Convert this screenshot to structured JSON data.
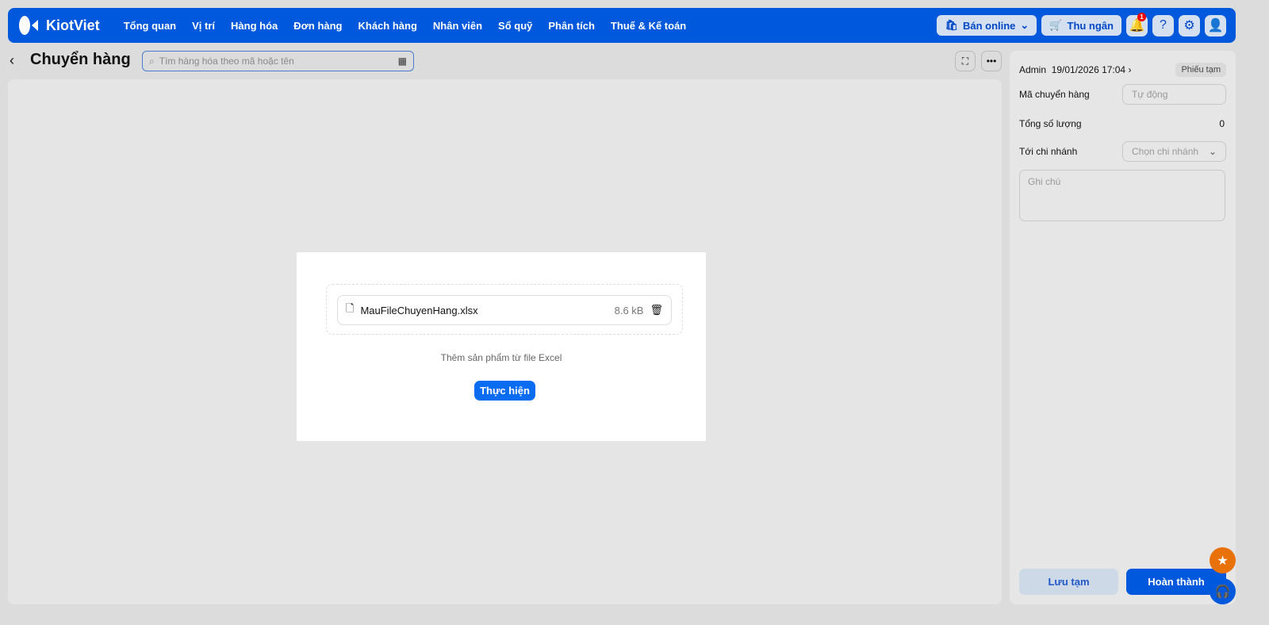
{
  "nav": {
    "brand": "KiotViet",
    "items": [
      "Tổng quan",
      "Vị trí",
      "Hàng hóa",
      "Đơn hàng",
      "Khách hàng",
      "Nhân viên",
      "Sổ quỹ",
      "Phân tích",
      "Thuế & Kế toán"
    ],
    "online": "Bán online",
    "cashier": "Thu ngân",
    "notifications": "1"
  },
  "page": {
    "title": "Chuyển hàng",
    "search_placeholder": "Tìm hàng hóa theo mã hoặc tên"
  },
  "upload": {
    "filename": "MauFileChuyenHang.xlsx",
    "size": "8.6 kB",
    "hint": "Thêm sản phẩm từ file Excel",
    "submit": "Thực hiện"
  },
  "side": {
    "user": "Admin",
    "datetime": "19/01/2026 17:04",
    "status": "Phiếu tạm",
    "code_label": "Mã chuyển hàng",
    "code_placeholder": "Tự động",
    "qty_label": "Tổng số lượng",
    "qty": "0",
    "branch_label": "Tới chi nhánh",
    "branch_placeholder": "Chọn chi nhánh",
    "note_placeholder": "Ghi chú",
    "save": "Lưu tạm",
    "done": "Hoàn thành"
  },
  "colors": {
    "brand": "#0058dc",
    "accent": "#0a6cf0",
    "star": "#e8710a"
  }
}
